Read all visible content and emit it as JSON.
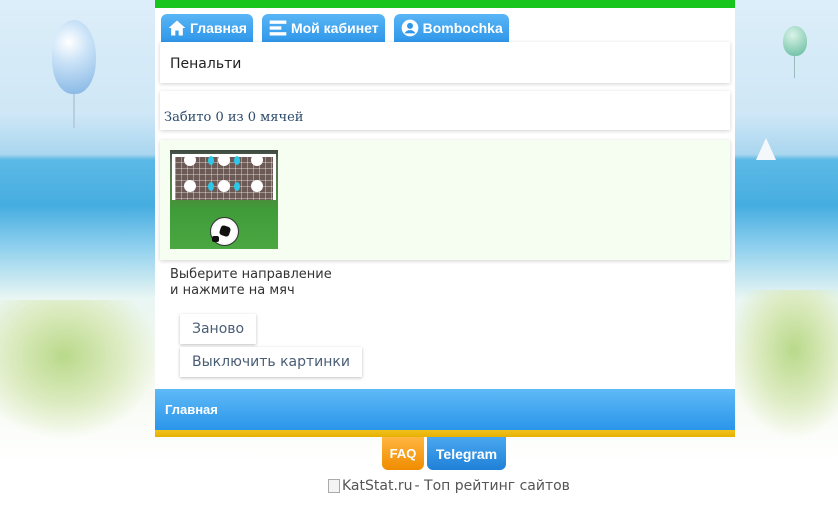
{
  "colors": {
    "topbar": "#18c51c",
    "tab_bg": "#2f97ea",
    "footer_bg": "#2a95ea",
    "footer_accent": "#f0c21f",
    "faq_bg": "#f08c00",
    "telegram_bg": "#1f80d8"
  },
  "tabs": [
    {
      "label": "Главная",
      "icon": "home-icon"
    },
    {
      "label": "Мой кабинет",
      "icon": "menu-icon"
    },
    {
      "label": "Bombochka",
      "icon": "user-circle-icon"
    }
  ],
  "page": {
    "title": "Пенальти",
    "score": "Забито 0 из 0 мячей",
    "hint_line1": "Выберите направление",
    "hint_line2": "и нажмите на мяч"
  },
  "buttons": {
    "restart": "Заново",
    "disable_images": "Выключить картинки"
  },
  "footer": {
    "home_link": "Главная",
    "faq": "FAQ",
    "telegram": "Telegram",
    "katstat_alt": "KatStat.ru",
    "katstat_text": " - Топ рейтинг сайтов"
  }
}
